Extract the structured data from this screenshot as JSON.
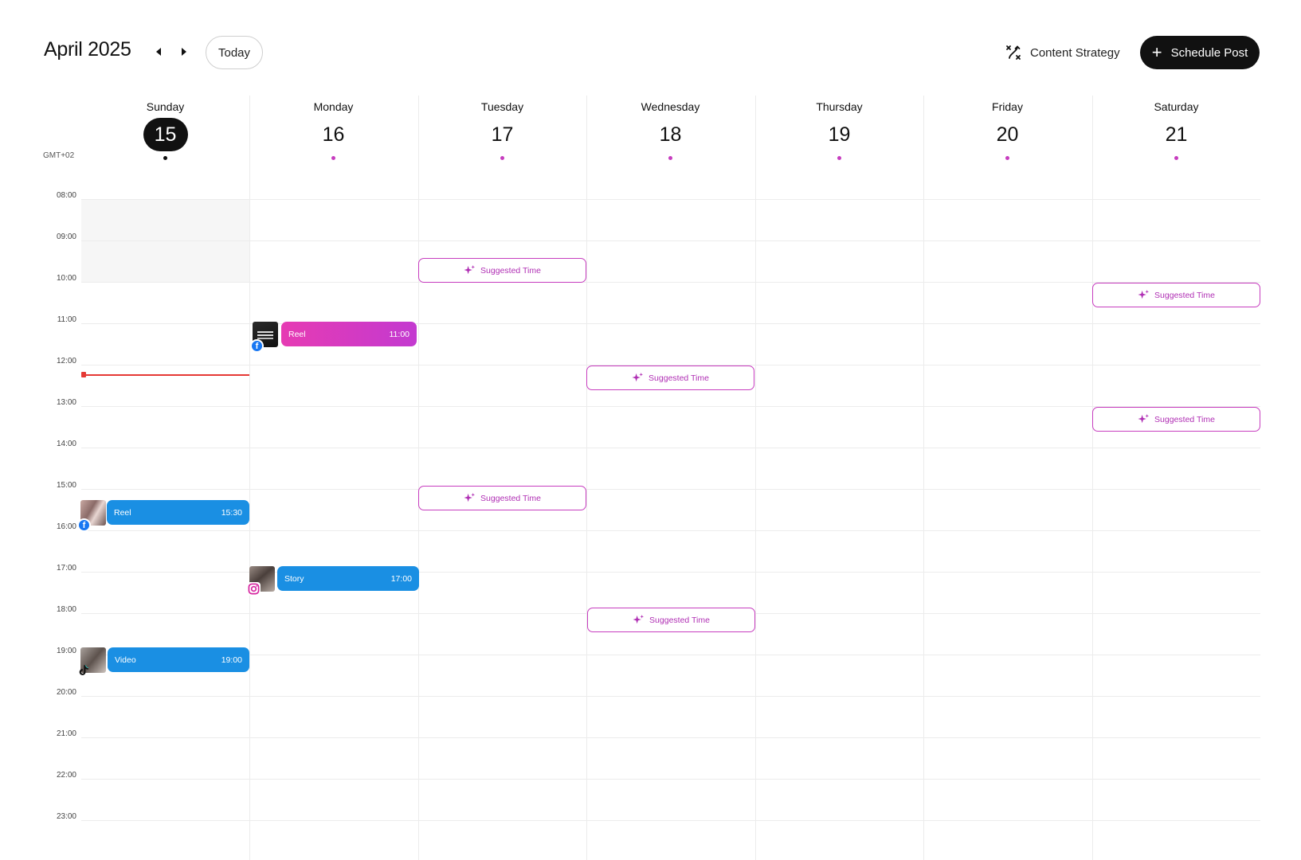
{
  "header": {
    "month_title": "April 2025",
    "today_label": "Today",
    "strategy_label": "Content Strategy",
    "schedule_label": "Schedule Post"
  },
  "timezone": "GMT+02",
  "days": [
    {
      "name": "Sunday",
      "num": "15"
    },
    {
      "name": "Monday",
      "num": "16"
    },
    {
      "name": "Tuesday",
      "num": "17"
    },
    {
      "name": "Wednesday",
      "num": "18"
    },
    {
      "name": "Thursday",
      "num": "19"
    },
    {
      "name": "Friday",
      "num": "20"
    },
    {
      "name": "Saturday",
      "num": "21"
    }
  ],
  "hours": [
    "08:00",
    "09:00",
    "10:00",
    "11:00",
    "12:00",
    "13:00",
    "14:00",
    "15:00",
    "16:00",
    "17:00",
    "18:00",
    "19:00",
    "20:00",
    "21:00",
    "22:00",
    "23:00"
  ],
  "suggested_label": "Suggested Time",
  "posts": [
    {
      "type": "Reel",
      "time": "11:00",
      "day": "Monday",
      "platform": "facebook"
    },
    {
      "type": "Reel",
      "time": "15:30",
      "day": "Sunday",
      "platform": "facebook"
    },
    {
      "type": "Story",
      "time": "17:00",
      "day": "Monday",
      "platform": "instagram"
    },
    {
      "type": "Video",
      "time": "19:00",
      "day": "Sunday",
      "platform": "tiktok"
    }
  ],
  "colors": {
    "accent": "#c73dbf",
    "post_blue": "#1a8fe3",
    "now_line": "#e53935",
    "primary_button": "#111111"
  },
  "icons": {
    "prev": "chevron-left-icon",
    "next": "chevron-right-icon",
    "strategy": "route-icon",
    "schedule": "plus-icon",
    "suggest": "sparkle-icon"
  }
}
